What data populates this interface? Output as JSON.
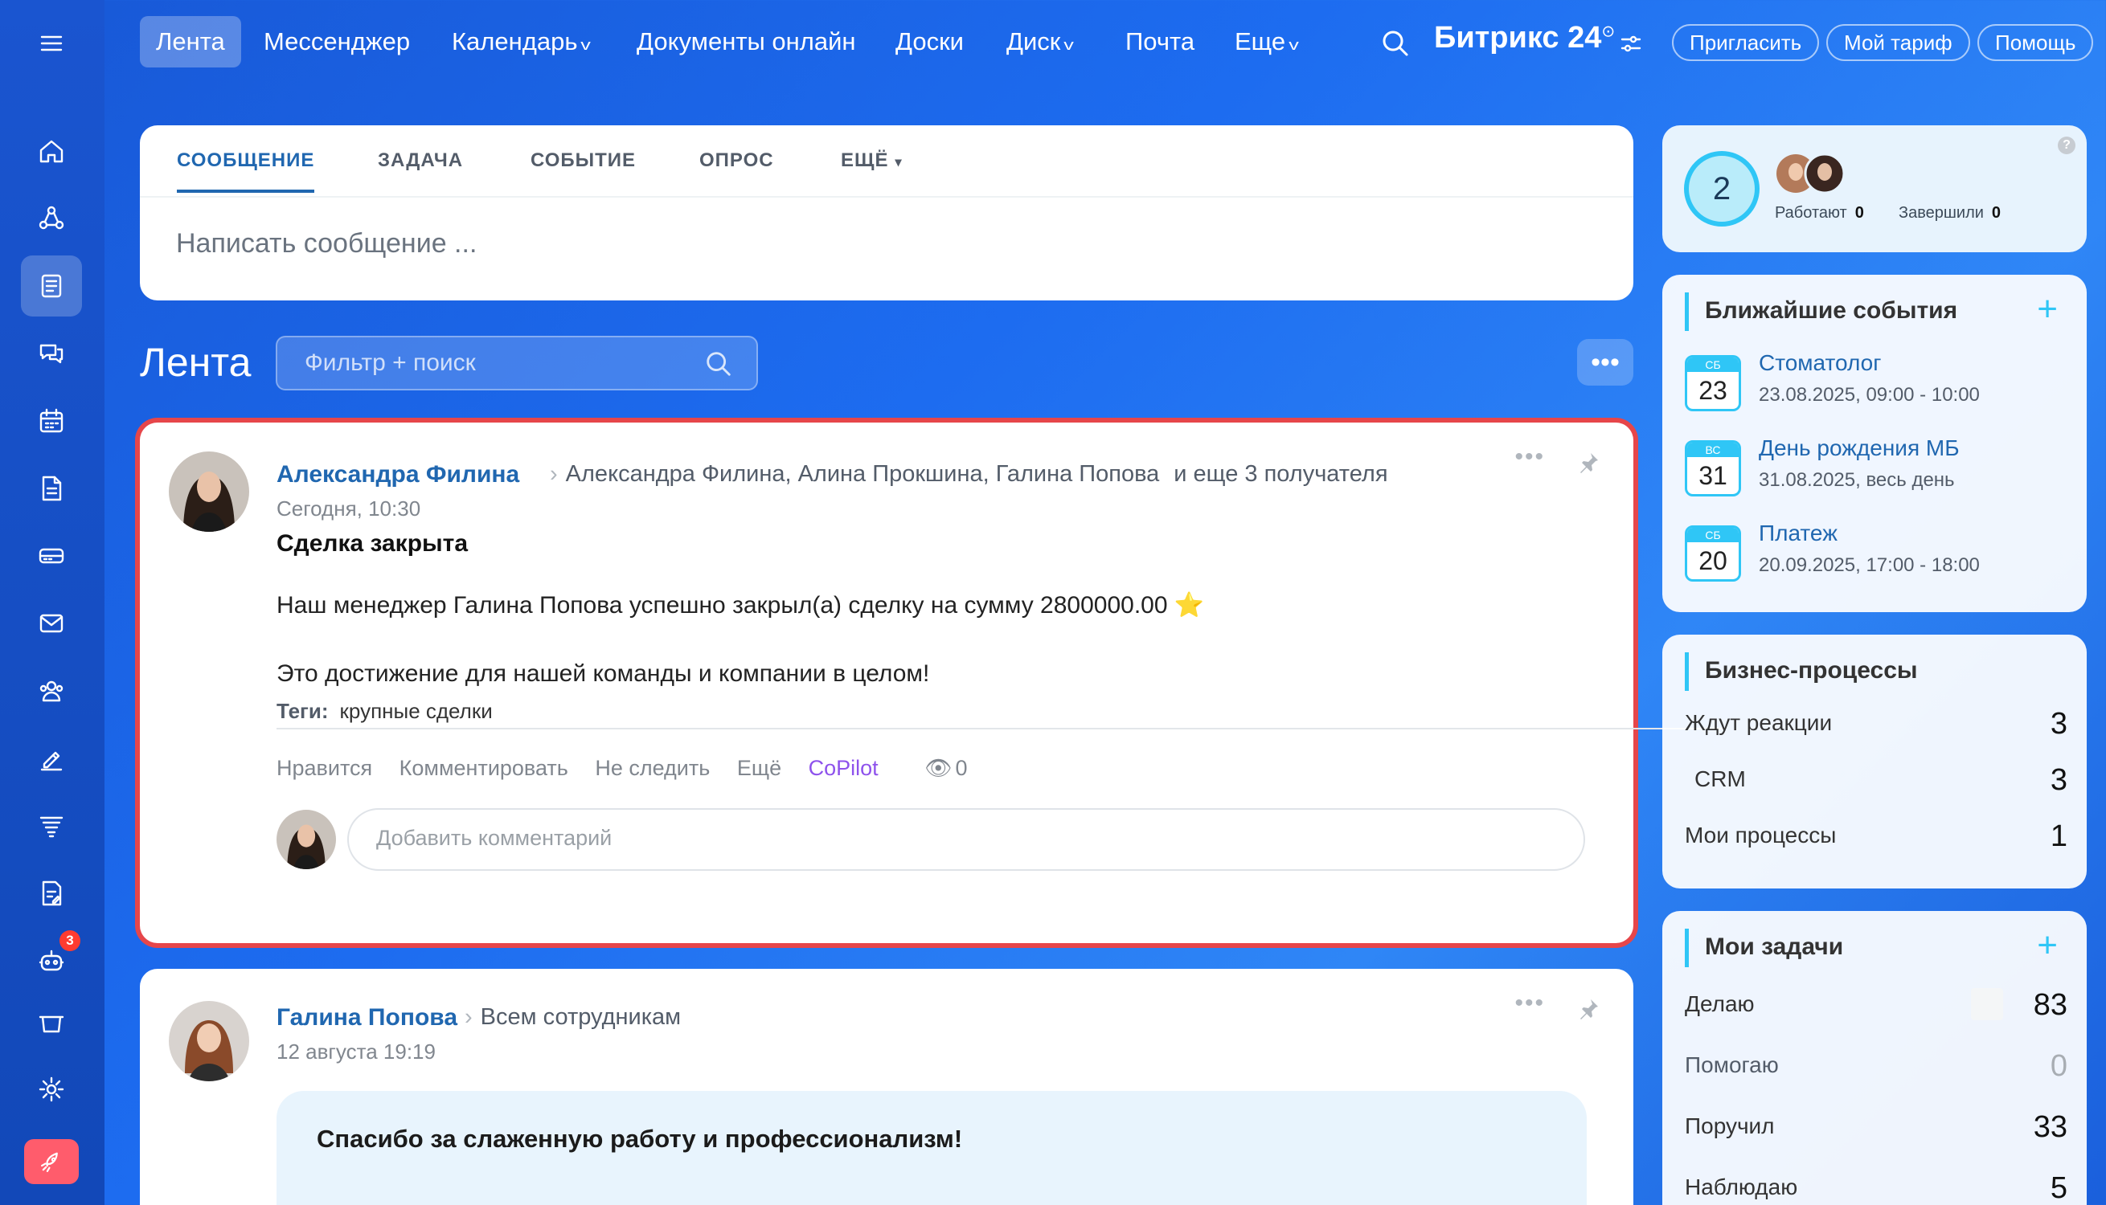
{
  "nav": {
    "items": [
      {
        "label": "Лента"
      },
      {
        "label": "Мессенджер"
      },
      {
        "label": "Календарь"
      },
      {
        "label": "Документы онлайн"
      },
      {
        "label": "Доски"
      },
      {
        "label": "Диск"
      },
      {
        "label": "Почта"
      },
      {
        "label": "Еще"
      }
    ],
    "brand": "Битрикс 24",
    "invite": "Пригласить",
    "tariff": "Мой тариф",
    "help": "Помощь"
  },
  "leftbar": {
    "icons": [
      "menu-icon",
      "home-icon",
      "crm-icon",
      "feed-icon",
      "chat-icon",
      "calendar-icon",
      "document-icon",
      "storage-icon",
      "mail-icon",
      "contacts-icon",
      "sign-icon",
      "filter-icon",
      "forms-icon",
      "robot-icon",
      "shop-icon",
      "settings-icon",
      "rocket-icon"
    ],
    "badge": "3"
  },
  "composer": {
    "tabs": [
      "СООБЩЕНИЕ",
      "ЗАДАЧА",
      "СОБЫТИЕ",
      "ОПРОС",
      "ЕЩЁ"
    ],
    "placeholder": "Написать сообщение ..."
  },
  "feed": {
    "title": "Лента",
    "filter_placeholder": "Фильтр + поиск"
  },
  "post1": {
    "author": "Александра Филина",
    "recipients": "Александра Филина, Алина Прокшина, Галина Попова",
    "more_recipients": "и еще 3 получателя",
    "time": "Сегодня, 10:30",
    "title": "Сделка закрыта",
    "text1": "Наш менеджер Галина Попова успешно закрыл(а) сделку на сумму 2800000.00 ⭐",
    "text2": "Это достижение для нашей команды и компании в целом!",
    "tags_label": "Теги:",
    "tags": "крупные сделки",
    "actions": {
      "like": "Нравится",
      "comment": "Комментировать",
      "unfollow": "Не следить",
      "more": "Ещё",
      "copilot": "CoPilot",
      "views": "0"
    },
    "comment_placeholder": "Добавить комментарий"
  },
  "post2": {
    "author": "Галина Попова",
    "recipients": "Всем сотрудникам",
    "time": "12 августа 19:19",
    "thanks": "Спасибо за слаженную работу и профессионализм!"
  },
  "widget_status": {
    "count": "2",
    "working_label": "Работают",
    "working": "0",
    "done_label": "Завершили",
    "done": "0",
    "help": "?"
  },
  "events": {
    "title": "Ближайшие события",
    "items": [
      {
        "dow": "СБ",
        "day": "23",
        "name": "Стоматолог",
        "date": "23.08.2025, 09:00 - 10:00"
      },
      {
        "dow": "ВС",
        "day": "31",
        "name": "День рождения МБ",
        "date": "31.08.2025, весь день"
      },
      {
        "dow": "СБ",
        "day": "20",
        "name": "Платеж",
        "date": "20.09.2025, 17:00 - 18:00"
      }
    ]
  },
  "bp": {
    "title": "Бизнес-процессы",
    "rows": [
      {
        "label": "Ждут реакции",
        "value": "3"
      },
      {
        "label": "CRM",
        "value": "3"
      },
      {
        "label": "Мои процессы",
        "value": "1"
      }
    ]
  },
  "tasks": {
    "title": "Мои задачи",
    "rows": [
      {
        "label": "Делаю",
        "value": "83"
      },
      {
        "label": "Помогаю",
        "value": "0"
      },
      {
        "label": "Поручил",
        "value": "33"
      },
      {
        "label": "Наблюдаю",
        "value": "5"
      }
    ]
  },
  "colors": {
    "accent": "#2fc6f6",
    "link": "#2067b0",
    "highlight": "#e6464a",
    "copilot": "#8e52ec"
  }
}
